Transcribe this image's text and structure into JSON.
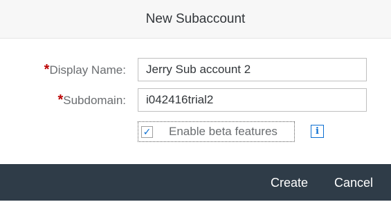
{
  "dialog": {
    "title": "New Subaccount",
    "fields": {
      "display_name": {
        "required_marker": "*",
        "label": "Display Name:",
        "value": "Jerry Sub account 2"
      },
      "subdomain": {
        "required_marker": "*",
        "label": "Subdomain:",
        "value": "i042416trial2"
      }
    },
    "beta": {
      "label": "Enable beta features",
      "checked": true,
      "check_glyph": "✓"
    },
    "info_icon": {
      "icon": "info-icon",
      "glyph": "i"
    },
    "buttons": {
      "create": "Create",
      "cancel": "Cancel"
    }
  },
  "colors": {
    "header_bg": "#f7f7f7",
    "footer_bg": "#2f3c48",
    "required": "#bb0000",
    "accent": "#0a6ed1"
  }
}
